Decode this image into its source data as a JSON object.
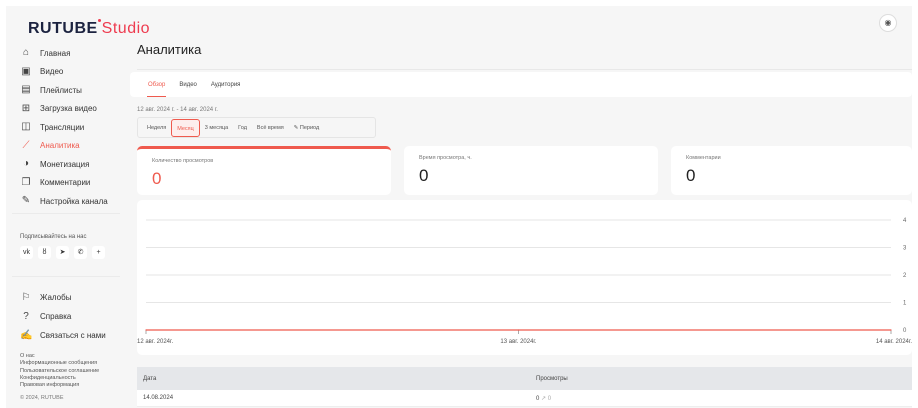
{
  "logo": {
    "brand": "RUTUBE",
    "product": "Studio"
  },
  "sidebar": {
    "items": [
      {
        "label": "Главная",
        "icon": "home-icon",
        "glyph": "⌂"
      },
      {
        "label": "Видео",
        "icon": "video-icon",
        "glyph": "▣"
      },
      {
        "label": "Плейлисты",
        "icon": "playlist-icon",
        "glyph": "▤"
      },
      {
        "label": "Загрузка видео",
        "icon": "upload-icon",
        "glyph": "⊞"
      },
      {
        "label": "Трансляции",
        "icon": "broadcast-icon",
        "glyph": "◫"
      },
      {
        "label": "Аналитика",
        "icon": "analytics-icon",
        "glyph": "⟋",
        "active": true
      },
      {
        "label": "Монетизация",
        "icon": "monetization-icon",
        "glyph": "◑"
      },
      {
        "label": "Комментарии",
        "icon": "comments-icon",
        "glyph": "❐"
      },
      {
        "label": "Настройка канала",
        "icon": "settings-wand-icon",
        "glyph": "✎"
      }
    ],
    "follow_label": "Подписывайтесь на нас",
    "socials": [
      {
        "icon": "vk-icon",
        "glyph": "vk"
      },
      {
        "icon": "ok-icon",
        "glyph": "ȣ"
      },
      {
        "icon": "telegram-icon",
        "glyph": "➤"
      },
      {
        "icon": "viber-icon",
        "glyph": "✆"
      },
      {
        "icon": "plus-icon",
        "glyph": "+"
      }
    ],
    "bottom_items": [
      {
        "label": "Жалобы",
        "icon": "flag-icon",
        "glyph": "⚐"
      },
      {
        "label": "Справка",
        "icon": "help-icon",
        "glyph": "?"
      },
      {
        "label": "Связаться с нами",
        "icon": "contact-icon",
        "glyph": "✍"
      }
    ],
    "links": [
      "О нас",
      "Информационные сообщения",
      "Пользовательское соглашение",
      "Конфиденциальность",
      "Правовая информация"
    ],
    "copyright": "© 2024, RUTUBE"
  },
  "header": {
    "title": "Аналитика",
    "action_icon": "record-icon"
  },
  "tabs": [
    "Обзор",
    "Видео",
    "Аудитория"
  ],
  "date_range": "12 авг. 2024 г. - 14 авг. 2024 г.",
  "periods": [
    "Неделя",
    "Месяц",
    "3 месяца",
    "Год",
    "Всё время",
    "Период"
  ],
  "active_period": "Месяц",
  "metrics": [
    {
      "label": "Количество просмотров",
      "value": "0"
    },
    {
      "label": "Время просмотра, ч.",
      "value": "0"
    },
    {
      "label": "Комментарии",
      "value": "0"
    }
  ],
  "chart_data": {
    "type": "line",
    "x": [
      "12 авг. 2024г.",
      "13 авг. 2024г.",
      "14 авг. 2024г."
    ],
    "series": [
      {
        "name": "Просмотры",
        "values": [
          0,
          0,
          0
        ],
        "color": "#ef5a4e"
      }
    ],
    "yticks": [
      "4",
      "3",
      "2",
      "1",
      "0"
    ],
    "ylim": [
      0,
      4
    ]
  },
  "table": {
    "headers": [
      "Дата",
      "Просмотры"
    ],
    "rows": [
      {
        "date": "14.08.2024",
        "views": "0",
        "trend": "↗ 0"
      }
    ]
  }
}
